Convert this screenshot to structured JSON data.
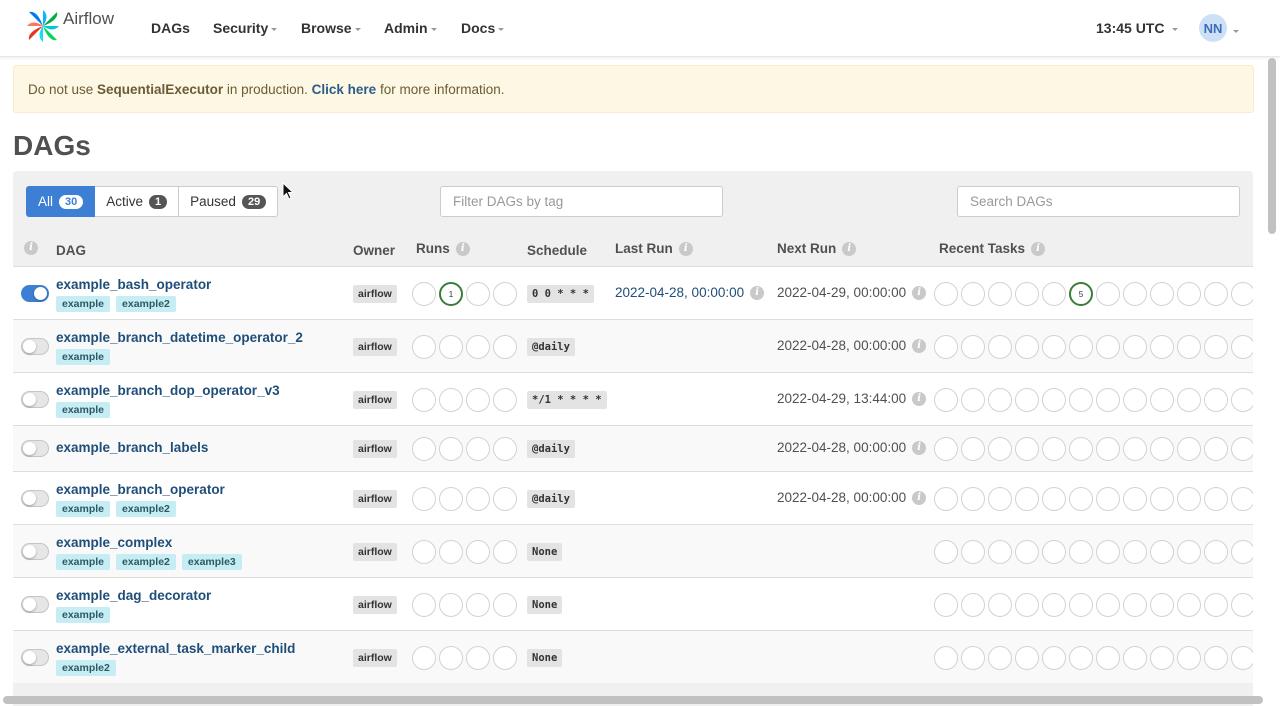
{
  "navbar": {
    "brand": "Airflow",
    "items": [
      "DAGs",
      "Security",
      "Browse",
      "Admin",
      "Docs"
    ],
    "time": "13:45 UTC",
    "user_initials": "NN"
  },
  "alert": {
    "prefix": "Do not use ",
    "executor": "SequentialExecutor",
    "middle": " in production. ",
    "link": "Click here",
    "suffix": " for more information."
  },
  "page_title": "DAGs",
  "filters": {
    "all": {
      "label": "All",
      "count": "30"
    },
    "active": {
      "label": "Active",
      "count": "1"
    },
    "paused": {
      "label": "Paused",
      "count": "29"
    },
    "tag_placeholder": "Filter DAGs by tag",
    "search_placeholder": "Search DAGs"
  },
  "columns": {
    "dag": "DAG",
    "owner": "Owner",
    "runs": "Runs",
    "schedule": "Schedule",
    "last_run": "Last Run",
    "next_run": "Next Run",
    "recent_tasks": "Recent Tasks"
  },
  "rows": [
    {
      "name": "example_bash_operator",
      "tags": [
        "example",
        "example2"
      ],
      "owner": "airflow",
      "schedule": "0 0 * * *",
      "last_run": "2022-04-28, 00:00:00",
      "next_run": "2022-04-29, 00:00:00",
      "active": true,
      "runs": [
        "",
        "1",
        "",
        ""
      ],
      "tasks": [
        "",
        "",
        "",
        "",
        "",
        "5",
        "",
        "",
        "",
        "",
        "",
        "",
        ""
      ]
    },
    {
      "name": "example_branch_datetime_operator_2",
      "tags": [
        "example"
      ],
      "owner": "airflow",
      "schedule": "@daily",
      "last_run": "",
      "next_run": "2022-04-28, 00:00:00",
      "active": false,
      "runs": [
        "",
        "",
        "",
        ""
      ],
      "tasks": [
        "",
        "",
        "",
        "",
        "",
        "",
        "",
        "",
        "",
        "",
        "",
        "",
        ""
      ]
    },
    {
      "name": "example_branch_dop_operator_v3",
      "tags": [
        "example"
      ],
      "owner": "airflow",
      "schedule": "*/1 * * * *",
      "last_run": "",
      "next_run": "2022-04-29, 13:44:00",
      "active": false,
      "runs": [
        "",
        "",
        "",
        ""
      ],
      "tasks": [
        "",
        "",
        "",
        "",
        "",
        "",
        "",
        "",
        "",
        "",
        "",
        "",
        ""
      ]
    },
    {
      "name": "example_branch_labels",
      "tags": [],
      "owner": "airflow",
      "schedule": "@daily",
      "last_run": "",
      "next_run": "2022-04-28, 00:00:00",
      "active": false,
      "runs": [
        "",
        "",
        "",
        ""
      ],
      "tasks": [
        "",
        "",
        "",
        "",
        "",
        "",
        "",
        "",
        "",
        "",
        "",
        "",
        ""
      ]
    },
    {
      "name": "example_branch_operator",
      "tags": [
        "example",
        "example2"
      ],
      "owner": "airflow",
      "schedule": "@daily",
      "last_run": "",
      "next_run": "2022-04-28, 00:00:00",
      "active": false,
      "runs": [
        "",
        "",
        "",
        ""
      ],
      "tasks": [
        "",
        "",
        "",
        "",
        "",
        "",
        "",
        "",
        "",
        "",
        "",
        "",
        ""
      ]
    },
    {
      "name": "example_complex",
      "tags": [
        "example",
        "example2",
        "example3"
      ],
      "owner": "airflow",
      "schedule": "None",
      "last_run": "",
      "next_run": "",
      "active": false,
      "runs": [
        "",
        "",
        "",
        ""
      ],
      "tasks": [
        "",
        "",
        "",
        "",
        "",
        "",
        "",
        "",
        "",
        "",
        "",
        "",
        ""
      ]
    },
    {
      "name": "example_dag_decorator",
      "tags": [
        "example"
      ],
      "owner": "airflow",
      "schedule": "None",
      "last_run": "",
      "next_run": "",
      "active": false,
      "runs": [
        "",
        "",
        "",
        ""
      ],
      "tasks": [
        "",
        "",
        "",
        "",
        "",
        "",
        "",
        "",
        "",
        "",
        "",
        "",
        ""
      ]
    },
    {
      "name": "example_external_task_marker_child",
      "tags": [
        "example2"
      ],
      "owner": "airflow",
      "schedule": "None",
      "last_run": "",
      "next_run": "",
      "active": false,
      "runs": [
        "",
        "",
        "",
        ""
      ],
      "tasks": [
        "",
        "",
        "",
        "",
        "",
        "",
        "",
        "",
        "",
        "",
        "",
        "",
        ""
      ]
    }
  ]
}
